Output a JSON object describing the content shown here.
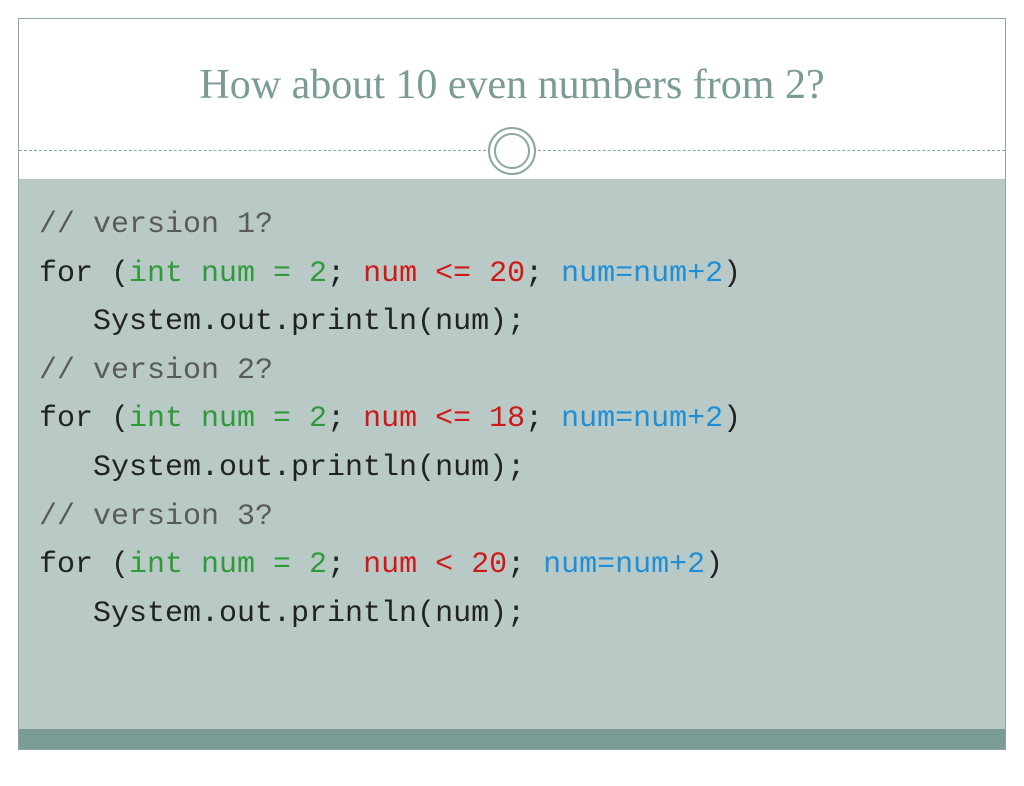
{
  "title": "How about 10 even numbers from 2?",
  "code": {
    "v1": {
      "comment": "// version 1?",
      "for_kw": "for (",
      "init": "int num = 2",
      "sep": "; ",
      "cond": "num <= 20",
      "inc": "num=num+2",
      "close": ")",
      "body": "   System.out.println(num);"
    },
    "v2": {
      "comment": "// version 2?",
      "for_kw": "for (",
      "init": "int num = 2",
      "sep": "; ",
      "cond": "num <= 18",
      "inc": "num=num+2",
      "close": ")",
      "body": "   System.out.println(num);"
    },
    "v3": {
      "comment": "// version 3?",
      "for_kw": "for (",
      "init": "int num = 2",
      "sep": "; ",
      "cond": "num < 20",
      "inc": "num=num+2",
      "close": ")",
      "body": "   System.out.println(num);"
    }
  }
}
